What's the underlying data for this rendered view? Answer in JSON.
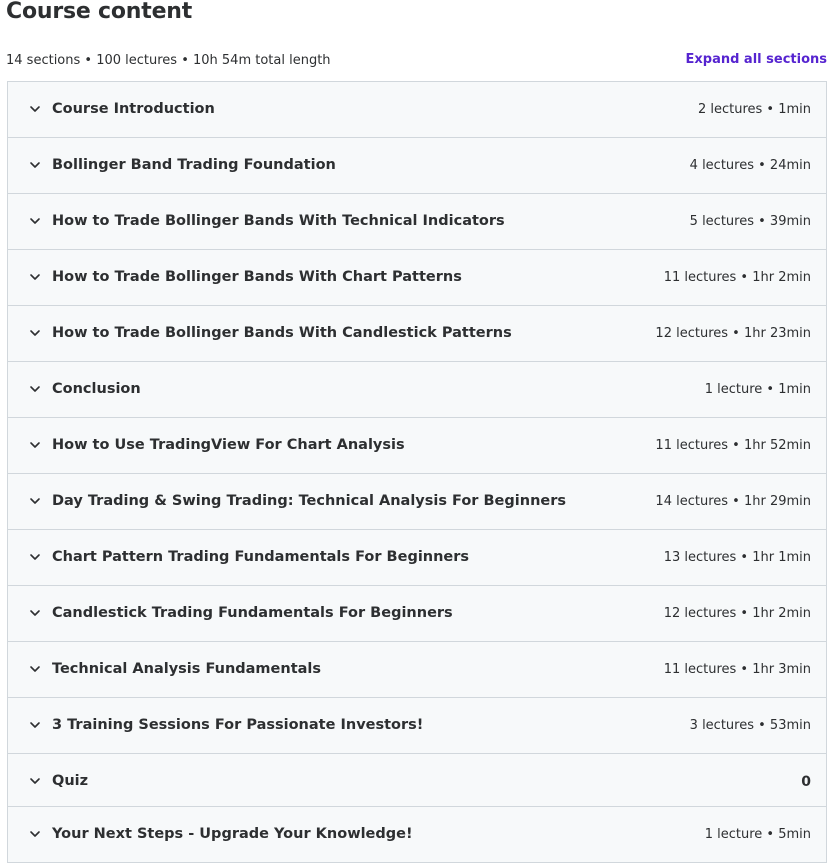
{
  "header": {
    "title": "Course content",
    "summary": "14 sections • 100 lectures • 10h 54m total length",
    "expand_label": "Expand all sections"
  },
  "icons": {
    "section_toggle": "chevron-down-icon"
  },
  "colors": {
    "link": "#5624d0",
    "text": "#2d2f31",
    "section_bg": "#f7f9fa",
    "border": "#d1d7dc"
  },
  "sections": [
    {
      "title": "Course Introduction",
      "meta": "2 lectures • 1min"
    },
    {
      "title": "Bollinger Band Trading Foundation",
      "meta": "4 lectures • 24min"
    },
    {
      "title": "How to Trade Bollinger Bands With Technical Indicators",
      "meta": "5 lectures • 39min"
    },
    {
      "title": "How to Trade Bollinger Bands With Chart Patterns",
      "meta": "11 lectures • 1hr 2min"
    },
    {
      "title": "How to Trade Bollinger Bands With Candlestick Patterns",
      "meta": "12 lectures • 1hr 23min"
    },
    {
      "title": "Conclusion",
      "meta": "1 lecture • 1min"
    },
    {
      "title": "How to Use TradingView For Chart Analysis",
      "meta": "11 lectures • 1hr 52min"
    },
    {
      "title": "Day Trading & Swing Trading: Technical Analysis For Beginners",
      "meta": "14 lectures • 1hr 29min"
    },
    {
      "title": "Chart Pattern Trading Fundamentals For Beginners",
      "meta": "13 lectures • 1hr 1min"
    },
    {
      "title": "Candlestick Trading Fundamentals For Beginners",
      "meta": "12 lectures • 1hr 2min"
    },
    {
      "title": "Technical Analysis Fundamentals",
      "meta": "11 lectures • 1hr 3min"
    },
    {
      "title": "3 Training Sessions For Passionate Investors!",
      "meta": "3 lectures • 53min"
    },
    {
      "title": "Quiz",
      "meta": "0"
    },
    {
      "title": "Your Next Steps - Upgrade Your Knowledge!",
      "meta": "1 lecture • 5min"
    }
  ]
}
